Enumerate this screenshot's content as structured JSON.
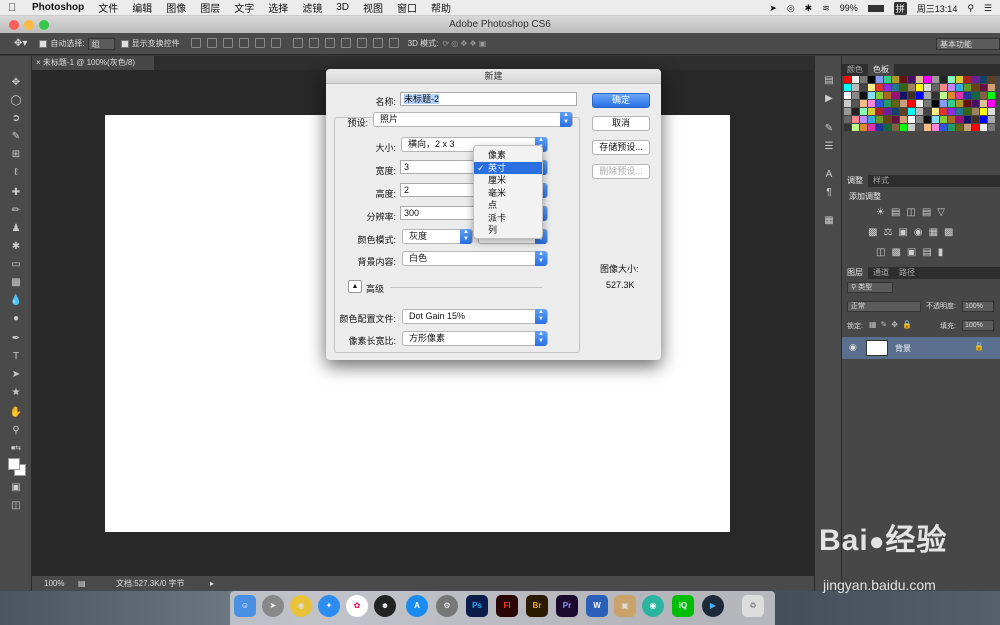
{
  "menubar": {
    "app": "Photoshop",
    "items": [
      "文件",
      "编辑",
      "图像",
      "图层",
      "文字",
      "选择",
      "滤镜",
      "3D",
      "视图",
      "窗口",
      "帮助"
    ],
    "battery": "99%",
    "input_method": "拼",
    "clock": "周三13:14"
  },
  "window": {
    "title": "Adobe Photoshop CS6"
  },
  "options_bar": {
    "auto_select_label": "自动选择:",
    "auto_select_value": "组",
    "show_transform_label": "显示变换控件",
    "mode_3d_label": "3D 模式:",
    "workspace_value": "基本功能"
  },
  "document_tab": {
    "title": "未标题-1 @ 100%(灰色/8)"
  },
  "status_bar": {
    "zoom": "100%",
    "doc_info": "文档:527.3K/0 字节"
  },
  "panels": {
    "swatch_tabs": [
      "颜色",
      "色板"
    ],
    "adjust_tabs": [
      "调整",
      "样式"
    ],
    "adjust_title": "添加调整",
    "layer_tabs": [
      "图层",
      "通道",
      "路径"
    ],
    "layer_filter": "类型",
    "blend_mode": "正常",
    "opacity_label": "不透明度:",
    "opacity_value": "100%",
    "lock_label": "锁定:",
    "fill_label": "填充:",
    "fill_value": "100%",
    "layer_name": "背景"
  },
  "dialog": {
    "title": "新建",
    "name_label": "名称:",
    "name_value": "未标题-2",
    "preset_label": "预设:",
    "preset_value": "照片",
    "size_label": "大小:",
    "size_value": "横向，2 x 3",
    "width_label": "宽度:",
    "width_value": "3",
    "height_label": "高度:",
    "height_value": "2",
    "resolution_label": "分辨率:",
    "resolution_value": "300",
    "color_mode_label": "颜色模式:",
    "color_mode_value": "灰度",
    "bg_label": "背景内容:",
    "bg_value": "白色",
    "advanced_label": "高级",
    "profile_label": "颜色配置文件:",
    "profile_value": "Dot Gain 15%",
    "aspect_label": "像素长宽比:",
    "aspect_value": "方形像素",
    "btn_ok": "确定",
    "btn_cancel": "取消",
    "btn_save_preset": "存储预设...",
    "btn_delete_preset": "删除预设...",
    "image_size_label": "图像大小:",
    "image_size_value": "527.3K",
    "unit_options": [
      "像素",
      "英寸",
      "厘米",
      "毫米",
      "点",
      "派卡",
      "列"
    ],
    "unit_selected_index": 1
  },
  "dock_labels": [
    "Ps",
    "Fl",
    "Br",
    "Pr"
  ],
  "watermark": {
    "brand": "Bai",
    "brand_cn": "经验",
    "url": "jingyan.baidu.com"
  }
}
